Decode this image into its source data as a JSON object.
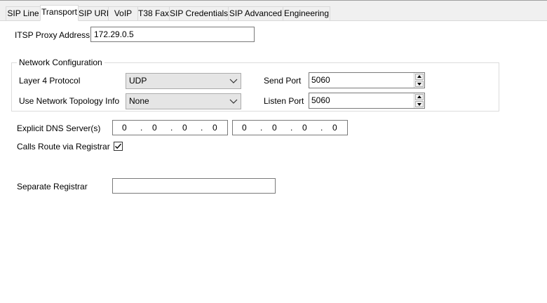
{
  "tabs": [
    "SIP Line",
    "Transport",
    "SIP URI",
    "VoIP",
    "T38 Fax",
    "SIP Credentials",
    "SIP Advanced",
    "Engineering"
  ],
  "active_tab": "Transport",
  "itsp_proxy": {
    "label": "ITSP Proxy Address",
    "value": "172.29.0.5"
  },
  "network_config": {
    "title": "Network Configuration",
    "layer4": {
      "label": "Layer 4 Protocol",
      "value": "UDP"
    },
    "topology": {
      "label": "Use Network Topology Info",
      "value": "None"
    },
    "send_port": {
      "label": "Send Port",
      "value": "5060"
    },
    "listen_port": {
      "label": "Listen Port",
      "value": "5060"
    }
  },
  "dns": {
    "label": "Explicit DNS Server(s)",
    "server1": [
      "0",
      "0",
      "0",
      "0"
    ],
    "server2": [
      "0",
      "0",
      "0",
      "0"
    ]
  },
  "calls_route": {
    "label": "Calls Route via Registrar",
    "checked": true
  },
  "separate_registrar": {
    "label": "Separate Registrar",
    "value": ""
  }
}
